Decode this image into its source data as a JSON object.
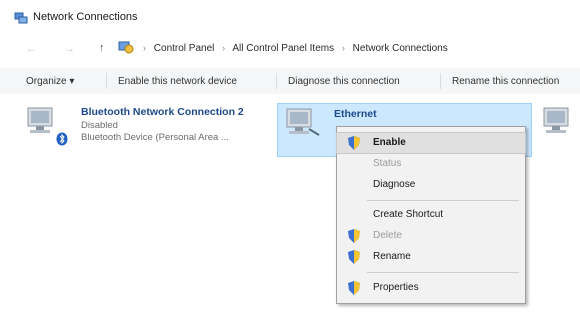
{
  "window": {
    "title": "Network Connections",
    "icon": "network-connections-icon"
  },
  "address_bar": {
    "back_icon": "back-arrow-icon",
    "forward_icon": "forward-arrow-icon",
    "up_icon": "up-arrow-icon",
    "location_icon": "control-panel-icon",
    "separator": "›",
    "crumbs": [
      "Control Panel",
      "All Control Panel Items",
      "Network Connections"
    ]
  },
  "command_bar": {
    "organize": "Organize ▾",
    "enable": "Enable this network device",
    "diagnose": "Diagnose this connection",
    "rename": "Rename this connection"
  },
  "connections": [
    {
      "name": "Bluetooth Network Connection 2",
      "status": "Disabled",
      "device": "Bluetooth Device (Personal Area ...",
      "icon": "network-adapter-icon",
      "badge_icon": "bluetooth-icon"
    },
    {
      "name": "Ethernet",
      "icon": "network-adapter-icon",
      "selected": true
    },
    {
      "icon": "network-adapter-icon"
    }
  ],
  "context_menu": {
    "items": [
      {
        "label": "Enable",
        "icon": "shield-icon",
        "bold": true,
        "highlighted": true,
        "disabled": false
      },
      {
        "label": "Status",
        "disabled": true
      },
      {
        "label": "Diagnose",
        "disabled": false
      },
      {
        "separator": true
      },
      {
        "label": "Create Shortcut",
        "disabled": false
      },
      {
        "label": "Delete",
        "icon": "shield-icon",
        "disabled": true
      },
      {
        "label": "Rename",
        "icon": "shield-icon",
        "disabled": false
      },
      {
        "separator": true
      },
      {
        "label": "Properties",
        "icon": "shield-icon",
        "disabled": false
      }
    ]
  },
  "colors": {
    "selection": "#cce8ff",
    "link_title": "#1d4a8a",
    "menu_bg": "#f2f2f2"
  }
}
